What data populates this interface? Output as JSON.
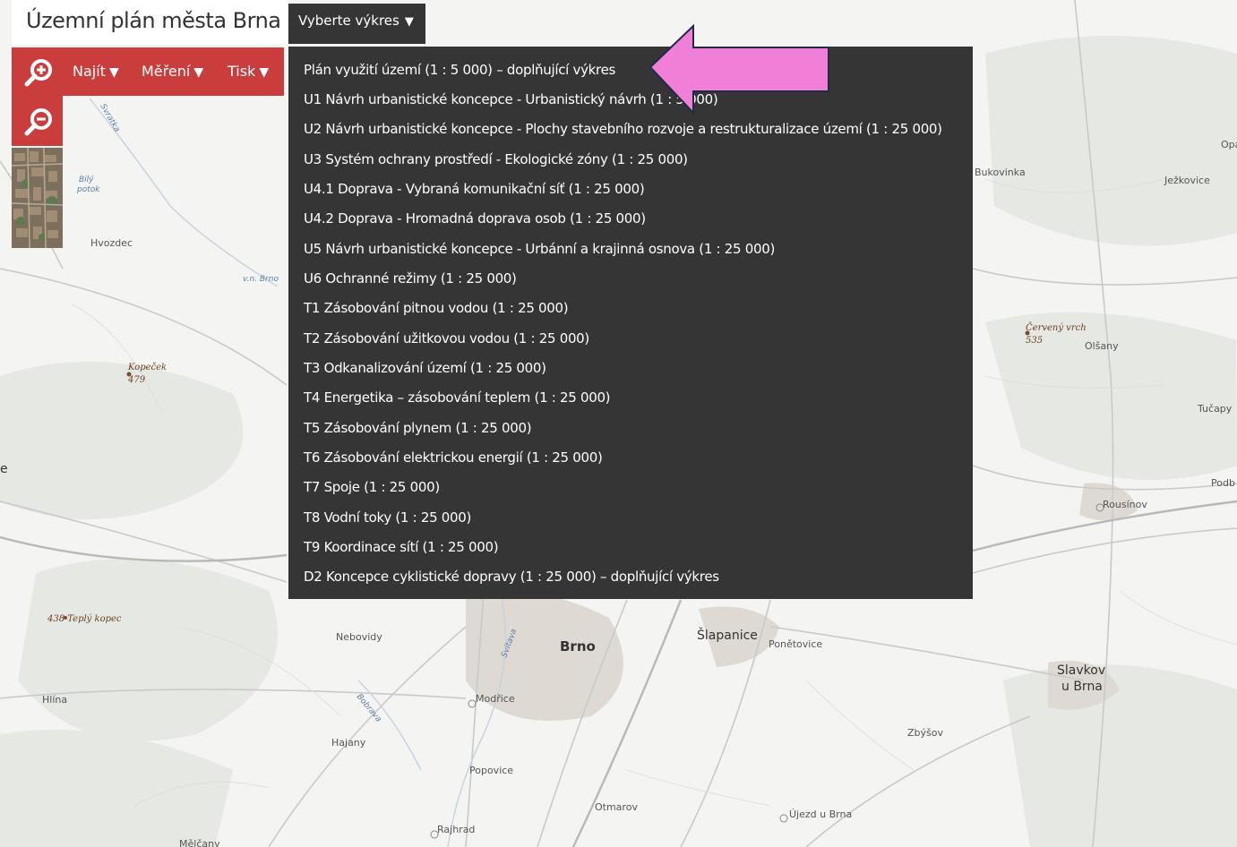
{
  "header": {
    "title": "Územní plán města Brna",
    "select_label": "Vyberte výkres",
    "caret": "▼"
  },
  "toolbar": {
    "zoom_in_icon": "zoom-in-icon",
    "zoom_out_icon": "zoom-out-icon",
    "find_label": "Najít",
    "measure_label": "Měření",
    "print_label": "Tisk",
    "caret": "▼"
  },
  "dropdown": {
    "items": [
      "Plán využití území (1 : 5 000) – doplňující výkres",
      "U1 Návrh urbanistické koncepce - Urbanistický návrh (1 : 5 000)",
      "U2 Návrh urbanistické koncepce - Plochy stavebního rozvoje a restrukturalizace území (1 : 25 000)",
      "U3 Systém ochrany prostředí - Ekologické zóny (1 : 25 000)",
      "U4.1 Doprava - Vybraná komunikační síť (1 : 25 000)",
      "U4.2 Doprava - Hromadná doprava osob (1 : 25 000)",
      "U5 Návrh urbanistické koncepce - Urbánní a krajinná osnova (1 : 25 000)",
      "U6 Ochranné režimy (1 : 25 000)",
      "T1 Zásobování pitnou vodou (1 : 25 000)",
      "T2 Zásobování užitkovou vodou (1 : 25 000)",
      "T3 Odkanalizování území (1 : 25 000)",
      "T4 Energetika – zásobování teplem (1 : 25 000)",
      "T5 Zásobování plynem (1 : 25 000)",
      "T6 Zásobování elektrickou energií (1 : 25 000)",
      "T7 Spoje (1 : 25 000)",
      "T8 Vodní toky (1 : 25 000)",
      "T9 Koordinace sítí (1 : 25 000)",
      "D2 Koncepce cyklistické dopravy (1 : 25 000) – doplňující výkres"
    ]
  },
  "annotation": {
    "arrow_color": "#f07fd8",
    "arrow_icon": "left-arrow-icon"
  },
  "map": {
    "labels": {
      "svratka_top": "Svratka",
      "bily_potok": "Bílý potok",
      "hvozdec": "Hvozdec",
      "vn_brno": "v.n. Brno",
      "kopecek": "Kopeček",
      "kopecek_alt": "479",
      "teply_kopec": "438 Teplý kopec",
      "hlina": "Hlína",
      "nebovidy": "Nebovidy",
      "hajany": "Hajany",
      "modrice": "Modřice",
      "popovice": "Popovice",
      "rajhrad": "Rajhrad",
      "otmarov": "Otmarov",
      "brno": "Brno",
      "svitava": "Svitava",
      "bobrava": "Bobrava",
      "slapanice": "Šlapanice",
      "ponetovice": "Ponětovice",
      "slavkov": "Slavkov",
      "u_brna": "u Brna",
      "zbysov": "Zbýšov",
      "ujezd": "Újezd u Brna",
      "rousinov": "Rousínov",
      "podb": "Podb",
      "tucapy": "Tučapy",
      "olsany": "Olšany",
      "cerveny_vrch": "Červený vrch",
      "cerveny_vrch_alt": "535",
      "bukovinka": "Bukovinka",
      "jezkovice": "Ježkovice",
      "opa": "Opa",
      "melcany": "Mělčany",
      "e_edge": "e"
    }
  }
}
